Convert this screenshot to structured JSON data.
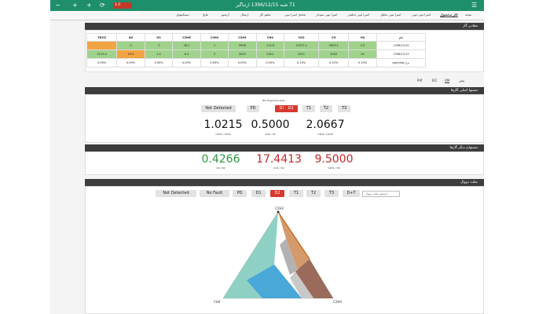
{
  "window": {
    "title": "شبه 1396/12/15 ارتباگیر T1",
    "badge": "1.0"
  },
  "tabs": [
    "کار محصول",
    "نتیجه",
    "اسرا تیپی تیپی",
    "اسرا تیپی تحلیل",
    "اسرا تیپی تحلیلی",
    "اسرا تیپی نمودار",
    "شامل اسرا تیپی",
    "تعلیم کار",
    "ارسال",
    "آرشیو",
    "نتایج",
    "دیسکیتهای"
  ],
  "matrix": {
    "header": "مقادیر گاز",
    "columns": [
      "نام",
      "H2",
      "CO",
      "CO2",
      "CH4",
      "C2H2",
      "C2H4",
      "C2H6",
      "O2",
      "N2",
      "TDCG"
    ],
    "rows": [
      [
        "1396/12/15",
        "0.5",
        "2629.2",
        "11227.1",
        "115.6",
        "9906",
        "1",
        "26.1",
        "3",
        "0",
        ""
      ],
      [
        "1396/12/13",
        "44",
        "1020",
        "2011",
        "116.1",
        "2003",
        "3",
        "8.4",
        "1.4",
        "29.5",
        "2113.4"
      ],
      [
        "ppm/day نرخ",
        "0.15%",
        "0.15%",
        "0.15%",
        "0.09%",
        "0.09%",
        "0.09%",
        "0.09%",
        "0.09%",
        "0.09%",
        "0.09%"
      ]
    ]
  },
  "subtabs": [
    "پیش",
    "IEC",
    "AM",
    "Pdf"
  ],
  "ratios_panel": {
    "header": "نسبتها اصلی گازها",
    "caption": "IEC Diagnosis Area",
    "buttons": [
      "Not Detected",
      "PD",
      "D1",
      "D2",
      "T1",
      "T2",
      "T3"
    ],
    "active": [
      "D1",
      "D2"
    ],
    "values": [
      {
        "value": "1.0215",
        "label": "C2H2 / C2H4"
      },
      {
        "value": "0.5000",
        "label": "CH4 / H2"
      },
      {
        "value": "2.0667",
        "label": "C2H4 / C2H6"
      }
    ]
  },
  "other_panel": {
    "header": "نسبتهای دیگر گازها",
    "values": [
      {
        "value": "0.4266",
        "label": "O2 / N2",
        "color": "#2e9a3f"
      },
      {
        "value": "17.4413",
        "label": "CO2 / CO",
        "color": "#c62828"
      },
      {
        "value": "9.5000",
        "label": "C2H2 / H2",
        "color": "#c62828"
      }
    ]
  },
  "duval_panel": {
    "header": "مثلث دووال",
    "buttons": [
      "Not Detected",
      "No Fault",
      "PD",
      "D1",
      "D2",
      "T1",
      "T2",
      "T3",
      "D+T"
    ],
    "active": [
      "D2"
    ],
    "input_placeholder": "جستجو مثلث دووال",
    "vertices": {
      "top": "C2H2",
      "left": "CH4",
      "right": "C2H4"
    }
  },
  "colors": {
    "accent": "#1f8f6b",
    "active_button": "#d63a2f",
    "panel_header": "#3d3d3d",
    "cell_green": "#9fd28a",
    "cell_orange": "#f2a444"
  }
}
